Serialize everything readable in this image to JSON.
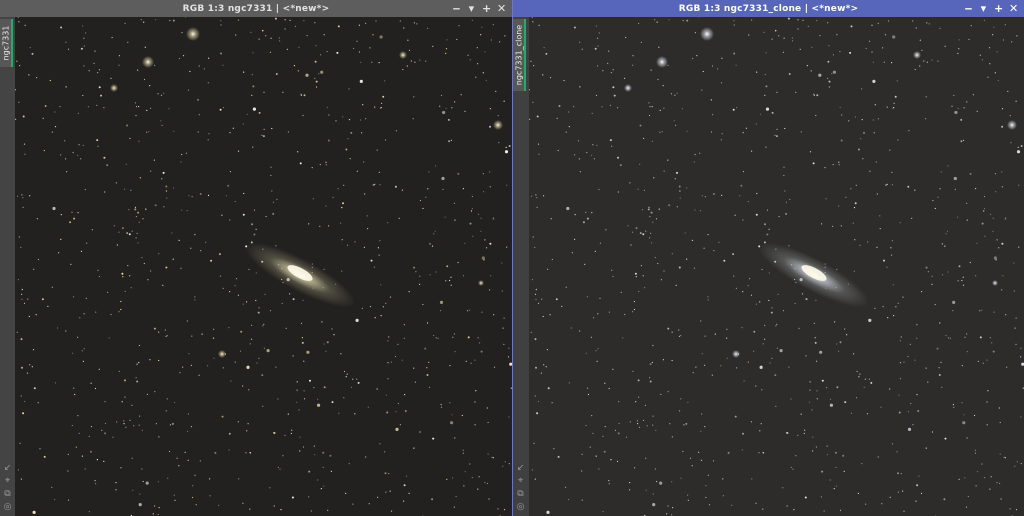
{
  "windows": [
    {
      "id": "left",
      "title": "RGB 1:3 ngc7331 | <*new*>",
      "tab_label": "ngc7331",
      "active": false,
      "controls": [
        "‒",
        "▾",
        "+",
        "✕"
      ],
      "side_icons": [
        "↙",
        "⌖",
        "⧉",
        "◎"
      ]
    },
    {
      "id": "right",
      "title": "RGB 1:3 ngc7331_clone | <*new*>",
      "tab_label": "ngc7331_clone",
      "active": true,
      "controls": [
        "‒",
        "▾",
        "+",
        "✕"
      ],
      "side_icons": [
        "↙",
        "⌖",
        "⧉",
        "◎"
      ]
    }
  ],
  "colors": {
    "active_title": "#5766bb",
    "inactive_title": "#5d5d5d",
    "tab_accent": "#1db068",
    "left_star_tint": "#f5e9b8",
    "right_star_tint": "#eef2ff"
  },
  "icons": {
    "minimize": "minimize-icon",
    "shade": "shade-icon",
    "maximize": "maximize-icon",
    "close": "close-icon"
  }
}
